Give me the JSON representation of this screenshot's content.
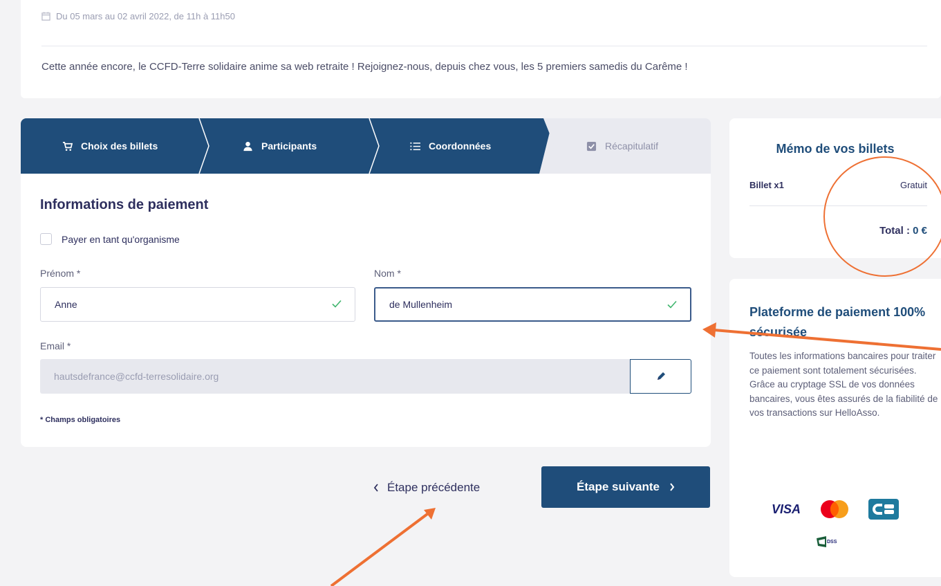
{
  "event": {
    "date": "Du 05 mars au 02 avril 2022, de 11h à 11h50",
    "description": "Cette année encore, le CCFD-Terre solidaire anime sa web retraite ! Rejoignez-nous, depuis chez vous, les 5 premiers samedis du Carême !"
  },
  "stepper": {
    "steps": [
      {
        "label": "Choix des billets",
        "icon": "cart-icon",
        "state": "done"
      },
      {
        "label": "Participants",
        "icon": "user-icon",
        "state": "done"
      },
      {
        "label": "Coordonnées",
        "icon": "list-icon",
        "state": "active"
      },
      {
        "label": "Récapitulatif",
        "icon": "checkbox-icon",
        "state": "inactive"
      }
    ],
    "active_color": "#1f4d7a"
  },
  "form": {
    "title": "Informations de paiement",
    "org_checkbox_label": "Payer en tant qu'organisme",
    "first_name_label": "Prénom *",
    "first_name_value": "Anne",
    "last_name_label": "Nom *",
    "last_name_value": "de Mullenheim",
    "email_label": "Email *",
    "email_value": "hautsdefrance@ccfd-terresolidaire.org",
    "required_note": "* Champs obligatoires"
  },
  "navigation": {
    "prev_label": "Étape précédente",
    "next_label": "Étape suivante"
  },
  "memo": {
    "title": "Mémo de vos billets",
    "ticket_label": "Billet x1",
    "ticket_price": "Gratuit",
    "total_label": "Total :",
    "total_value": "0 €"
  },
  "security": {
    "title": "Plateforme de paiement 100% sécurisée",
    "text": "Toutes les informations bancaires pour traiter ce paiement sont totalement sécurisées. Grâce au cryptage SSL de vos données bancaires, vous êtes assurés de la fiabilité de vos transactions sur HelloAsso.",
    "visa_label": "VISA"
  },
  "annotation_color": "#ee7033"
}
